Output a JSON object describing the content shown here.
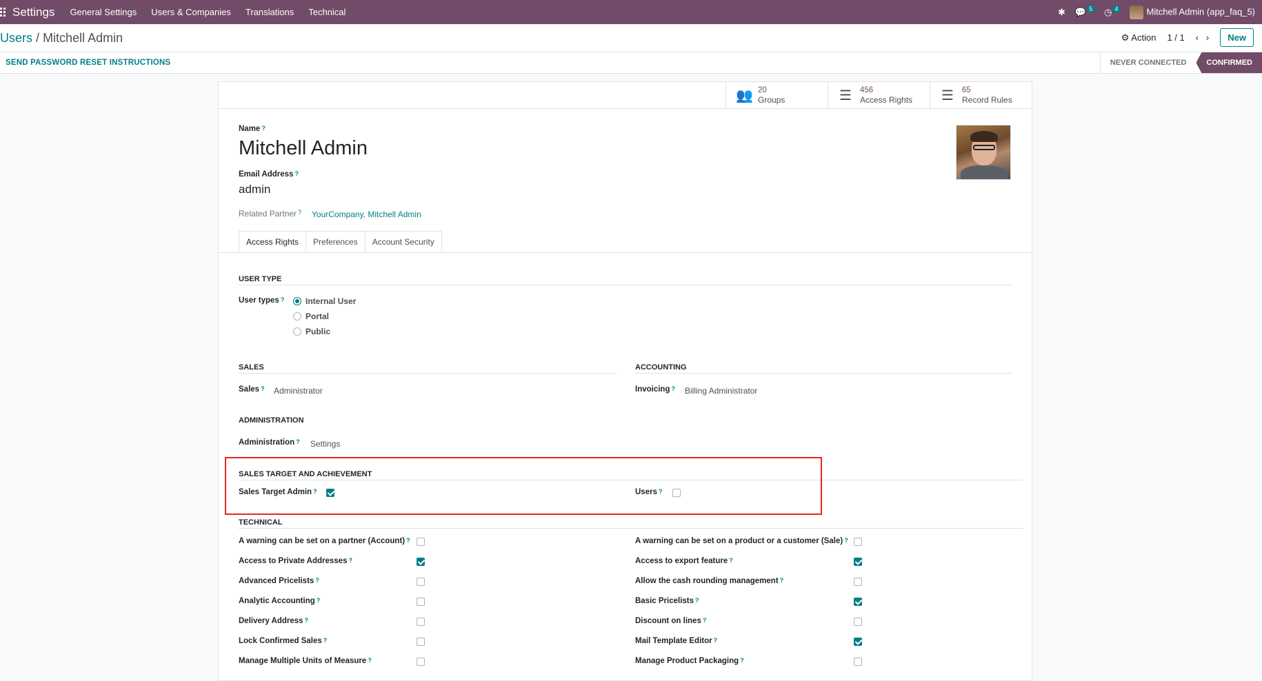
{
  "navbar": {
    "app_title": "Settings",
    "menus": [
      "General Settings",
      "Users & Companies",
      "Translations",
      "Technical"
    ],
    "messages_count": "5",
    "activities_count": "4",
    "user_label": "Mitchell Admin (app_faq_5)"
  },
  "control": {
    "breadcrumb_parent": "Users",
    "breadcrumb_sep": "/",
    "breadcrumb_current": "Mitchell Admin",
    "action_label": "Action",
    "pager": "1 / 1",
    "new_label": "New"
  },
  "status": {
    "reset_label": "SEND PASSWORD RESET INSTRUCTIONS",
    "stages": [
      "NEVER CONNECTED",
      "CONFIRMED"
    ],
    "active_stage": "CONFIRMED"
  },
  "stats": [
    {
      "count": "20",
      "label": "Groups",
      "icon": "users-icon"
    },
    {
      "count": "456",
      "label": "Access Rights",
      "icon": "list-icon"
    },
    {
      "count": "65",
      "label": "Record Rules",
      "icon": "list-icon"
    }
  ],
  "form": {
    "name_label": "Name",
    "name_value": "Mitchell Admin",
    "email_label": "Email Address",
    "email_value": "admin",
    "partner_label": "Related Partner",
    "partner_value": "YourCompany, Mitchell Admin",
    "help_mark": "?"
  },
  "tabs": [
    "Access Rights",
    "Preferences",
    "Account Security"
  ],
  "access": {
    "user_type_section": "USER TYPE",
    "user_types_label": "User types",
    "user_type_options": [
      "Internal User",
      "Portal",
      "Public"
    ],
    "user_type_selected": "Internal User",
    "sales_section": "SALES",
    "sales_label": "Sales",
    "sales_value": "Administrator",
    "accounting_section": "ACCOUNTING",
    "invoicing_label": "Invoicing",
    "invoicing_value": "Billing Administrator",
    "administration_section": "ADMINISTRATION",
    "administration_label": "Administration",
    "administration_value": "Settings",
    "target_section": "SALES TARGET AND ACHIEVEMENT",
    "target_admin_label": "Sales Target Admin",
    "target_admin_checked": true,
    "target_users_label": "Users",
    "target_users_checked": false,
    "technical_section": "TECHNICAL",
    "technical_left": [
      {
        "label": "A warning can be set on a partner (Account)",
        "checked": false
      },
      {
        "label": "Access to Private Addresses",
        "checked": true
      },
      {
        "label": "Advanced Pricelists",
        "checked": false
      },
      {
        "label": "Analytic Accounting",
        "checked": false
      },
      {
        "label": "Delivery Address",
        "checked": false
      },
      {
        "label": "Lock Confirmed Sales",
        "checked": false
      },
      {
        "label": "Manage Multiple Units of Measure",
        "checked": false
      }
    ],
    "technical_right": [
      {
        "label": "A warning can be set on a product or a customer (Sale)",
        "checked": false
      },
      {
        "label": "Access to export feature",
        "checked": true
      },
      {
        "label": "Allow the cash rounding management",
        "checked": false
      },
      {
        "label": "Basic Pricelists",
        "checked": true
      },
      {
        "label": "Discount on lines",
        "checked": false
      },
      {
        "label": "Mail Template Editor",
        "checked": true
      },
      {
        "label": "Manage Product Packaging",
        "checked": false
      }
    ]
  },
  "colors": {
    "brand": "#714b67",
    "accent": "#017e84",
    "highlight": "#e3261f"
  }
}
